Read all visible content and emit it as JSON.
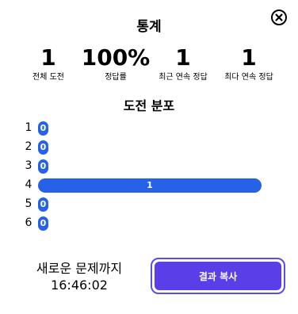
{
  "modal": {
    "title": "통계",
    "close_icon": "close-icon"
  },
  "stats": [
    {
      "value": "1",
      "label": "전체 도전"
    },
    {
      "value": "100%",
      "label": "정답률"
    },
    {
      "value": "1",
      "label": "최근 연속 정답"
    },
    {
      "value": "1",
      "label": "최다 연속 정답"
    }
  ],
  "distribution": {
    "title": "도전 분포",
    "max_value": 1,
    "rows": [
      {
        "label": "1",
        "value": 0
      },
      {
        "label": "2",
        "value": 0
      },
      {
        "label": "3",
        "value": 0
      },
      {
        "label": "4",
        "value": 1
      },
      {
        "label": "5",
        "value": 0
      },
      {
        "label": "6",
        "value": 0
      }
    ]
  },
  "footer": {
    "next_label": "새로운 문제까지",
    "countdown": "16:46:02",
    "share_label": "결과 복사"
  },
  "colors": {
    "bar": "#2562e8",
    "share_button": "#5a3ee8",
    "share_border": "#5b4ee6"
  }
}
